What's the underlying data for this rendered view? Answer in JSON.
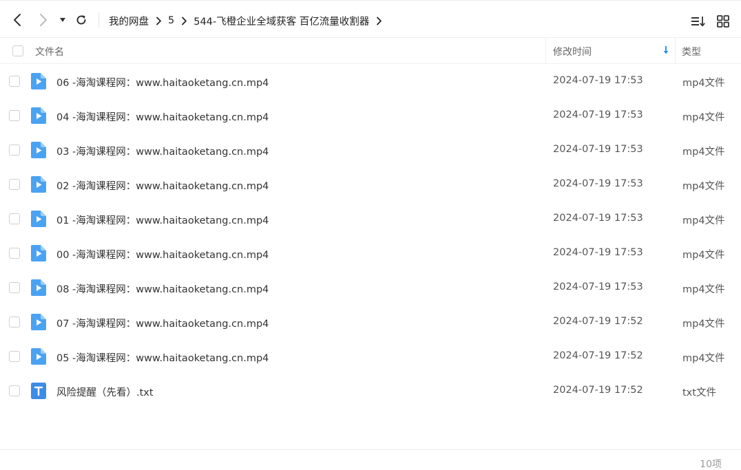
{
  "toolbar": {
    "back_icon": "chevron-left-icon",
    "forward_icon": "chevron-right-icon",
    "history_icon": "caret-down-icon",
    "refresh_icon": "refresh-icon",
    "breadcrumb": [
      "我的网盘",
      "5",
      "544-飞橙企业全域获客 百亿流量收割器"
    ],
    "sort_icon": "sort-list-icon",
    "grid_icon": "grid-view-icon"
  },
  "header": {
    "name": "文件名",
    "date": "修改时间",
    "type": "类型"
  },
  "files": [
    {
      "name": "06 -海淘课程网：www.haitaoketang.cn.mp4",
      "date": "2024-07-19 17:53",
      "type": "mp4文件",
      "kind": "video"
    },
    {
      "name": "04 -海淘课程网：www.haitaoketang.cn.mp4",
      "date": "2024-07-19 17:53",
      "type": "mp4文件",
      "kind": "video"
    },
    {
      "name": "03 -海淘课程网：www.haitaoketang.cn.mp4",
      "date": "2024-07-19 17:53",
      "type": "mp4文件",
      "kind": "video"
    },
    {
      "name": "02 -海淘课程网：www.haitaoketang.cn.mp4",
      "date": "2024-07-19 17:53",
      "type": "mp4文件",
      "kind": "video"
    },
    {
      "name": "01 -海淘课程网：www.haitaoketang.cn.mp4",
      "date": "2024-07-19 17:53",
      "type": "mp4文件",
      "kind": "video"
    },
    {
      "name": "00 -海淘课程网：www.haitaoketang.cn.mp4",
      "date": "2024-07-19 17:53",
      "type": "mp4文件",
      "kind": "video"
    },
    {
      "name": "08 -海淘课程网：www.haitaoketang.cn.mp4",
      "date": "2024-07-19 17:53",
      "type": "mp4文件",
      "kind": "video"
    },
    {
      "name": "07 -海淘课程网：www.haitaoketang.cn.mp4",
      "date": "2024-07-19 17:52",
      "type": "mp4文件",
      "kind": "video"
    },
    {
      "name": "05 -海淘课程网：www.haitaoketang.cn.mp4",
      "date": "2024-07-19 17:52",
      "type": "mp4文件",
      "kind": "video"
    },
    {
      "name": "风险提醒（先看）.txt",
      "date": "2024-07-19 17:52",
      "type": "txt文件",
      "kind": "text"
    }
  ],
  "footer": {
    "count": "10项"
  },
  "colors": {
    "accent": "#2b93f5",
    "video_icon": "#4aa3f2",
    "text_icon": "#3d8be8"
  }
}
